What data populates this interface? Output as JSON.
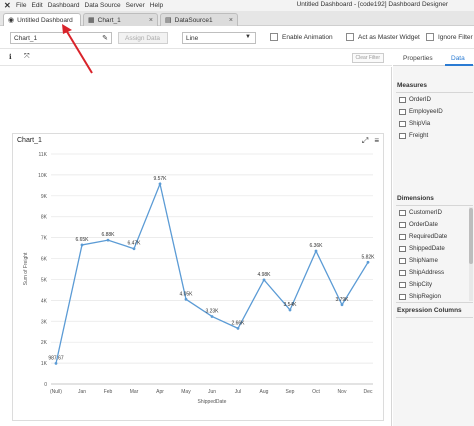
{
  "window": {
    "title": "Untitled Dashboard - [code192] Dashboard Designer",
    "menu": [
      "File",
      "Edit",
      "Dashboard",
      "Data Source",
      "Server",
      "Help"
    ]
  },
  "tabs": [
    {
      "label": "Untitled Dashboard",
      "icon": "dashboard-icon"
    },
    {
      "label": "Chart_1",
      "icon": "chart-icon"
    },
    {
      "label": "DataSource1",
      "icon": "datasource-icon"
    }
  ],
  "toolbar": {
    "name_value": "Chart_1",
    "assign_data_label": "Assign Data",
    "chart_type_value": "Line",
    "enable_animation_label": "Enable Animation",
    "master_widget_label": "Act as Master Widget",
    "ignore_filter_label": "Ignore Filter"
  },
  "subbar": {
    "clear_filter_label": "Clear Filter"
  },
  "chart_card": {
    "title": "Chart_1"
  },
  "panel": {
    "tabs": {
      "properties": "Properties",
      "data": "Data"
    },
    "measures_label": "Measures",
    "measures": [
      "OrderID",
      "EmployeeID",
      "ShipVia",
      "Freight"
    ],
    "dimensions_label": "Dimensions",
    "dimensions": [
      "CustomerID",
      "OrderDate",
      "RequiredDate",
      "ShippedDate",
      "ShipName",
      "ShipAddress",
      "ShipCity",
      "ShipRegion"
    ],
    "expression_label": "Expression Columns"
  },
  "chart_data": {
    "type": "line",
    "categories": [
      "(Null)",
      "Jan",
      "Feb",
      "Mar",
      "Apr",
      "May",
      "Jun",
      "Jul",
      "Aug",
      "Sep",
      "Oct",
      "Nov",
      "Dec"
    ],
    "values": [
      987.67,
      6650,
      6880,
      6470,
      9570,
      4050,
      3230,
      2660,
      4980,
      3540,
      6360,
      3790,
      5820
    ],
    "data_labels": [
      "987.67",
      "6.65K",
      "6.88K",
      "6.47K",
      "9.57K",
      "4.05K",
      "3.23K",
      "2.66K",
      "4.98K",
      "3.54K",
      "6.36K",
      "3.79K",
      "5.82K"
    ],
    "xlabel": "ShippedDate",
    "ylabel": "Sum of Freight",
    "ylim": [
      0,
      11000
    ],
    "yticks": [
      "0",
      "1K",
      "2K",
      "3K",
      "4K",
      "5K",
      "6K",
      "7K",
      "8K",
      "9K",
      "10K",
      "11K"
    ],
    "line_color": "#5b9bd5",
    "grid": true
  },
  "colors": {
    "accent": "#2a7bd3",
    "annotation": "#d9232a"
  }
}
